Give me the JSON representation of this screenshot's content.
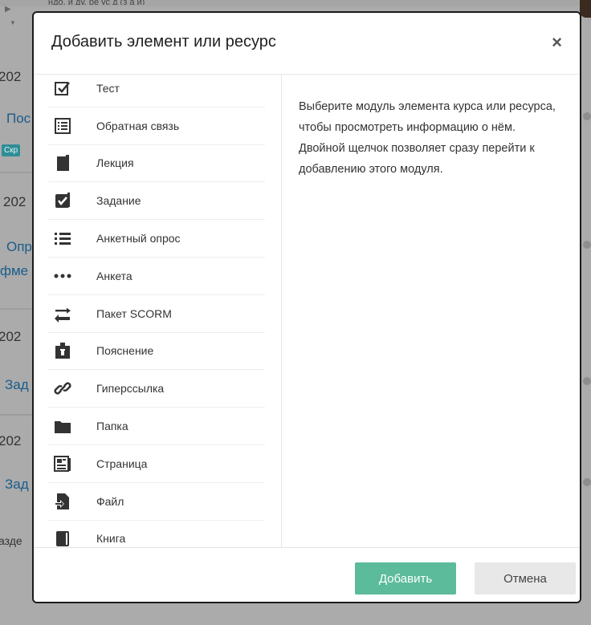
{
  "background": {
    "fragments": [
      {
        "text": "202",
        "kind": "text"
      },
      {
        "text": "Пос",
        "kind": "link"
      },
      {
        "text": "202",
        "kind": "text"
      },
      {
        "text": "Опр",
        "kind": "link"
      },
      {
        "text": "фме",
        "kind": "link"
      },
      {
        "text": "202",
        "kind": "text"
      },
      {
        "text": "Зад",
        "kind": "link"
      },
      {
        "text": "202",
        "kind": "text"
      },
      {
        "text": "Зад",
        "kind": "link"
      },
      {
        "text": "азде",
        "kind": "text"
      }
    ],
    "badge": "Скр",
    "status_line": "ндо, и ду, ре ус д (з а и)"
  },
  "modal": {
    "title": "Добавить элемент или ресурс",
    "close_label": "×",
    "items": [
      {
        "label": "Тест",
        "icon": "quiz-icon"
      },
      {
        "label": "Обратная связь",
        "icon": "feedback-icon"
      },
      {
        "label": "Лекция",
        "icon": "lesson-icon"
      },
      {
        "label": "Задание",
        "icon": "assignment-icon"
      },
      {
        "label": "Анкетный опрос",
        "icon": "survey-icon"
      },
      {
        "label": "Анкета",
        "icon": "questionnaire-icon"
      },
      {
        "label": "Пакет SCORM",
        "icon": "scorm-icon"
      },
      {
        "label": "Пояснение",
        "icon": "label-icon"
      },
      {
        "label": "Гиперссылка",
        "icon": "url-icon"
      },
      {
        "label": "Папка",
        "icon": "folder-icon"
      },
      {
        "label": "Страница",
        "icon": "page-icon"
      },
      {
        "label": "Файл",
        "icon": "file-icon"
      },
      {
        "label": "Книга",
        "icon": "book-icon"
      }
    ],
    "description": "Выберите модуль элемента курса или ресурса, чтобы просмотреть информацию о нём. Двойной щелчок позволяет сразу перейти к добавлению этого модуля.",
    "add_button": "Добавить",
    "cancel_button": "Отмена"
  },
  "colors": {
    "accent": "#5cbb9a",
    "link": "#1a5c8c",
    "overlay": "#ababab"
  }
}
